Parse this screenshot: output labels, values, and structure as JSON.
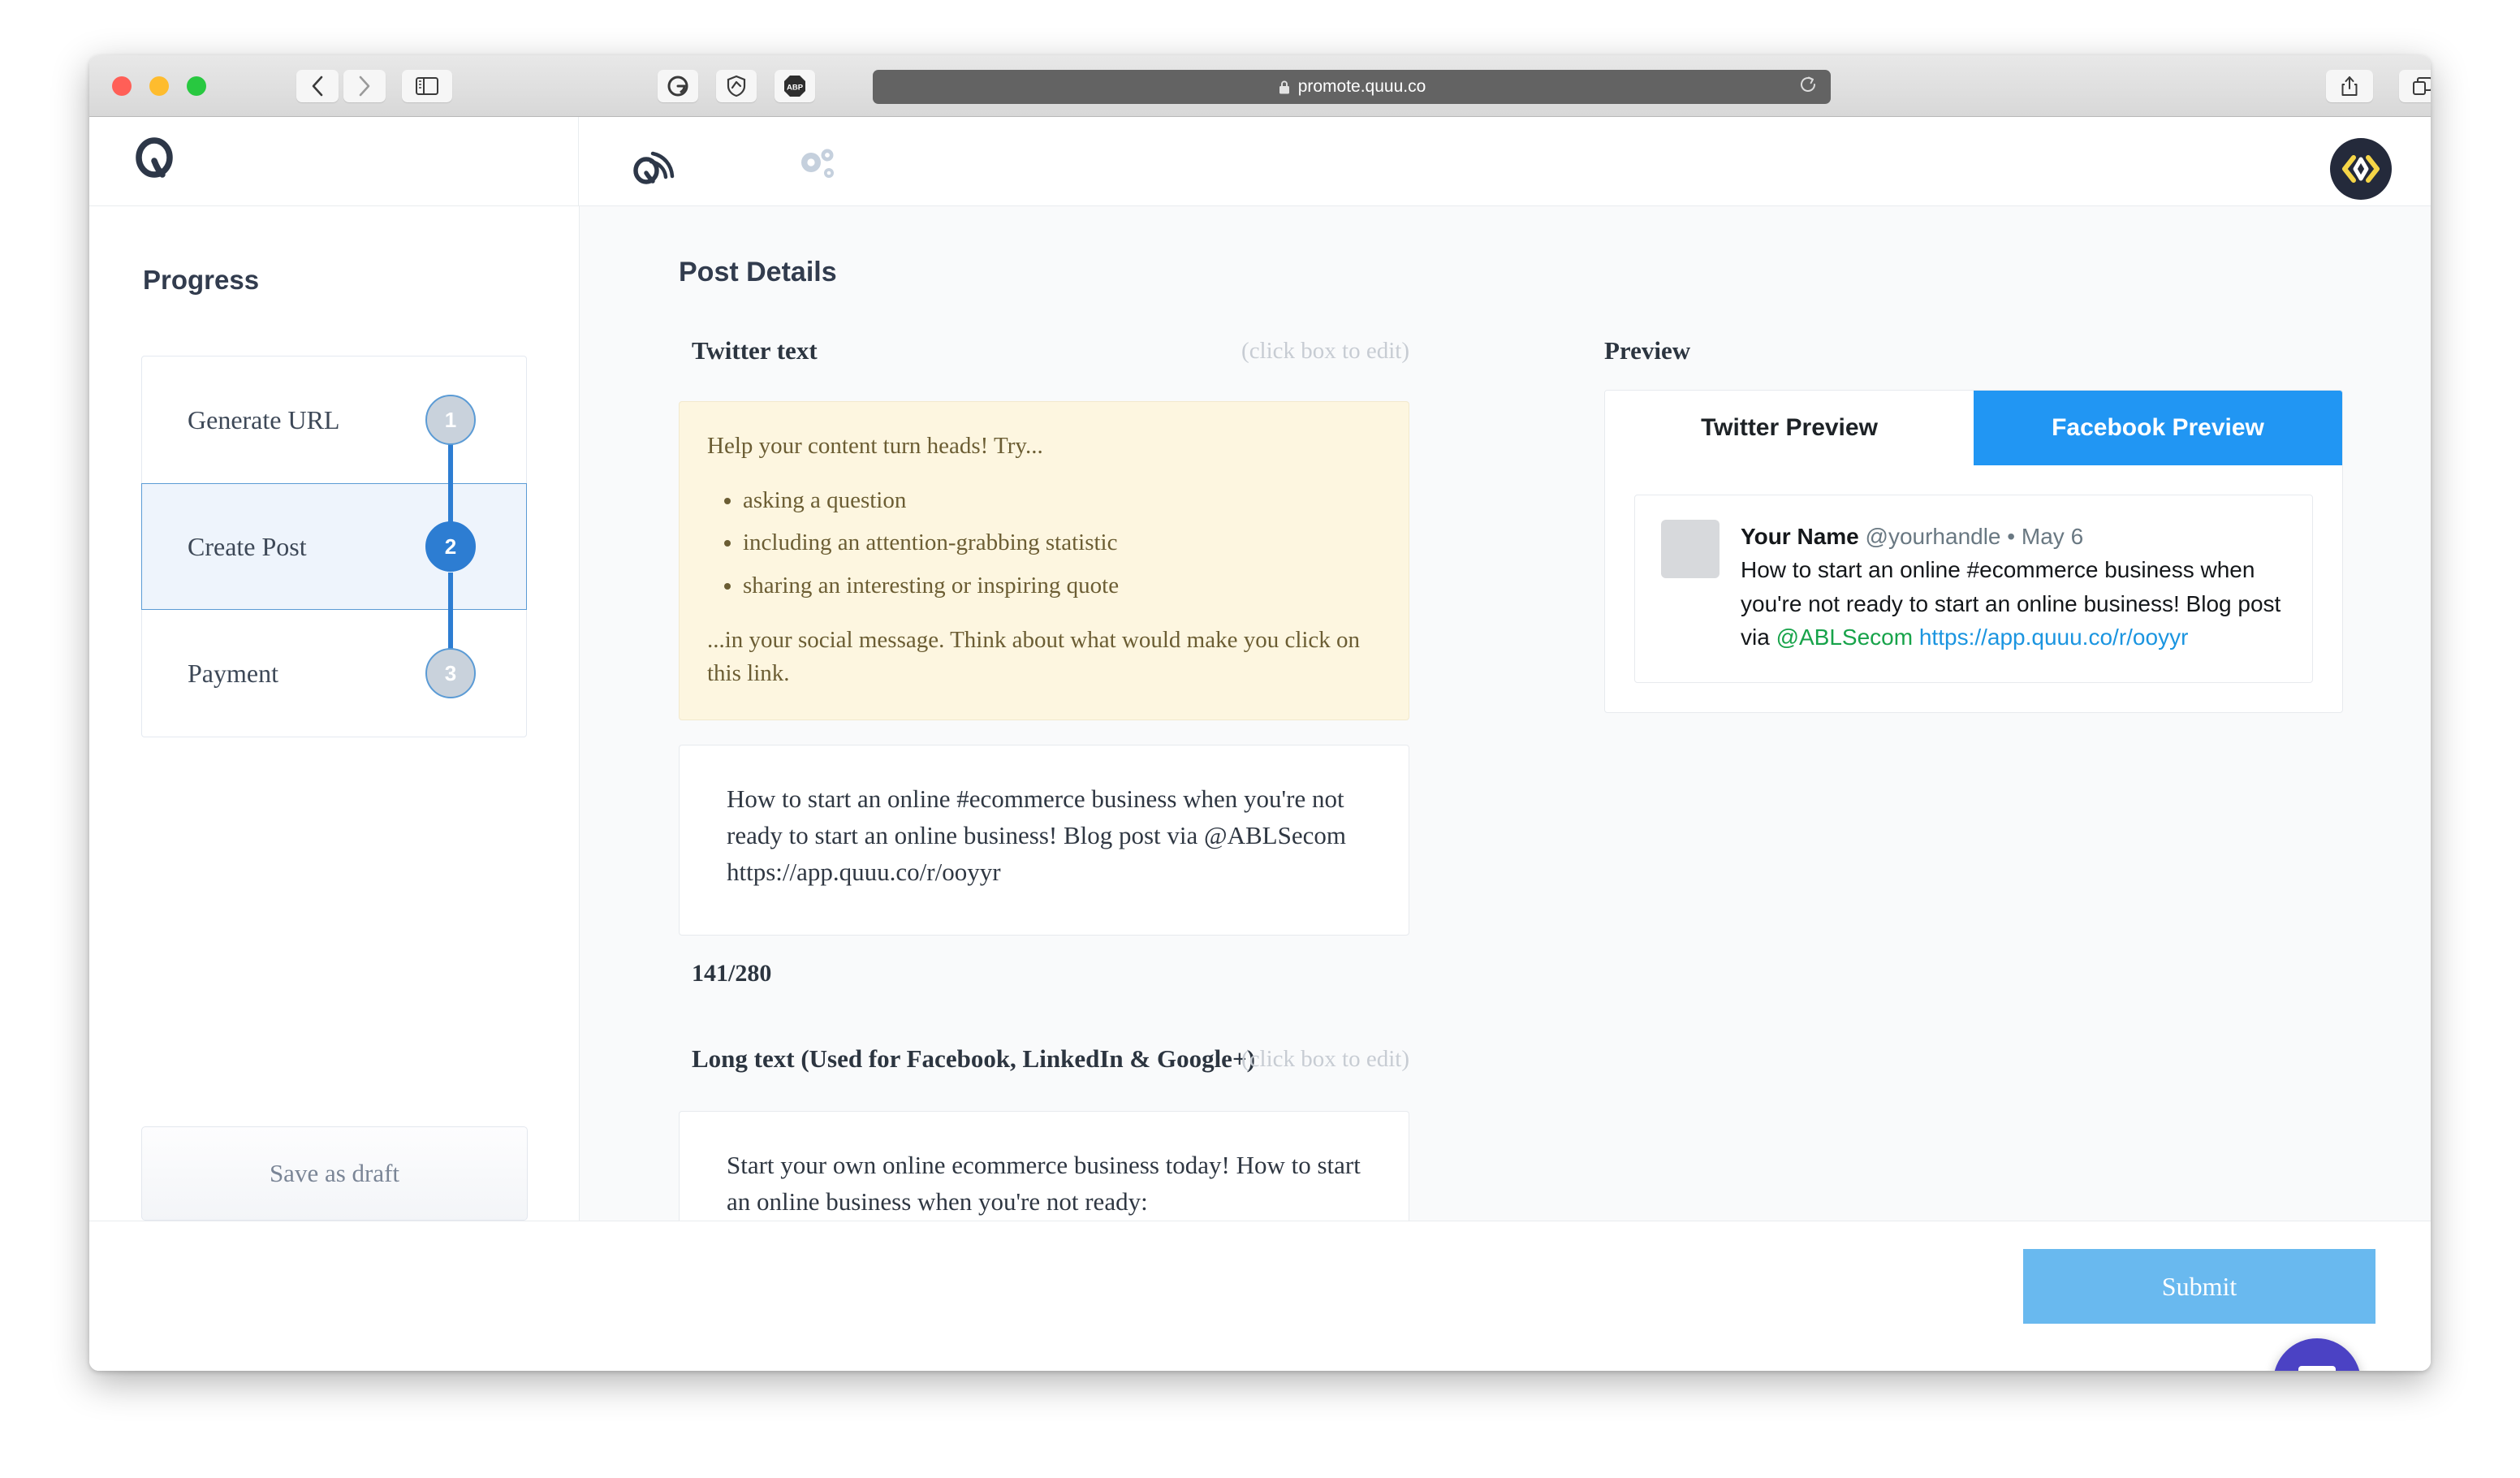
{
  "browser": {
    "url": "promote.quuu.co",
    "lock_icon": "lock-icon",
    "reload_icon": "reload-icon",
    "back_icon": "chevron-left-icon",
    "forward_icon": "chevron-right-icon",
    "sidebar_icon": "sidebar-toggle-icon",
    "extensions": [
      {
        "name": "grammarly-extension-icon",
        "label": "G"
      },
      {
        "name": "privacy-shield-extension-icon",
        "label": ""
      },
      {
        "name": "adblock-plus-extension-icon",
        "label": "ABP"
      }
    ],
    "share_icon": "share-icon",
    "tab_overview_icon": "tab-overview-icon",
    "new_tab_label": "+"
  },
  "app_header": {
    "logo": "quuu-q-logo",
    "promote_icon": "quuu-promote-icon",
    "settings_icon": "gears-settings-icon",
    "avatar_icon": "user-avatar-chevrons-logo"
  },
  "sidebar": {
    "title": "Progress",
    "steps": [
      {
        "label": "Generate URL",
        "number": "1",
        "state": "pending"
      },
      {
        "label": "Create Post",
        "number": "2",
        "state": "active"
      },
      {
        "label": "Payment",
        "number": "3",
        "state": "pending"
      }
    ],
    "save_draft_label": "Save as draft"
  },
  "main": {
    "page_title": "Post Details",
    "twitter_field": {
      "label": "Twitter text",
      "edit_hint": "(click box to edit)",
      "tip": {
        "intro": "Help your content turn heads! Try...",
        "bullets": [
          "asking a question",
          "including an attention-grabbing statistic",
          "sharing an interesting or inspiring quote"
        ],
        "outro": "...in your social message. Think about what would make you click on this link."
      },
      "value": "How to start an online #ecommerce business when you're not ready to start an online business! Blog post via @ABLSecom https://app.quuu.co/r/ooyyr",
      "counter": "141/280"
    },
    "long_field": {
      "label": "Long text (Used for Facebook, LinkedIn & Google+)",
      "edit_hint": "(click box to edit)",
      "value": "Start your own online ecommerce business today! How to start an online business when you're not ready: https://app.quuu.co/r/ooyyr"
    }
  },
  "preview": {
    "title": "Preview",
    "tabs": [
      {
        "label": "Twitter Preview",
        "active": false
      },
      {
        "label": "Facebook Preview",
        "active": true
      }
    ],
    "post": {
      "avatar": "preview-avatar-placeholder",
      "name": "Your Name",
      "handle": "@yourhandle",
      "separator": "•",
      "date": "May 6",
      "text_before_mention": "How to start an online #ecommerce business when you're not ready to start an online business! Blog post via ",
      "mention": "@ABLSecom",
      "link": "https://app.quuu.co/r/ooyyr"
    }
  },
  "footer": {
    "submit_label": "Submit"
  },
  "chat": {
    "icon": "intercom-chat-icon"
  },
  "colors": {
    "accent_blue": "#2196f3",
    "submit_blue": "#69b9ef",
    "step_active": "#2d7dd2",
    "tip_bg": "#fdf6e0",
    "mention_green": "#17a34a",
    "link_blue": "#1b95e0",
    "intercom_purple": "#4b42c4"
  }
}
